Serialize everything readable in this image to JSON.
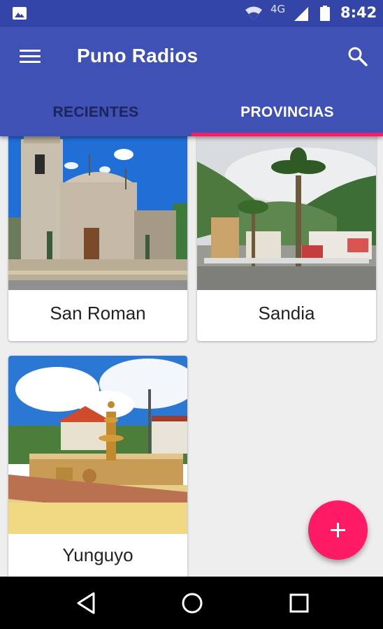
{
  "status_bar": {
    "network": "4G",
    "time": "8:42",
    "icons": [
      "image-notification-icon",
      "wifi-icon",
      "signal-icon",
      "battery-icon"
    ]
  },
  "app_bar": {
    "title": "Puno Radios",
    "menu_icon": "hamburger-menu-icon",
    "search_icon": "search-icon"
  },
  "tabs": [
    {
      "label": "RECIENTES",
      "selected": false
    },
    {
      "label": "PROVINCIAS",
      "selected": true
    }
  ],
  "provinces": [
    {
      "name": "San Roman"
    },
    {
      "name": "Sandia"
    },
    {
      "name": "Yunguyo"
    }
  ],
  "fab": {
    "icon": "plus-icon"
  },
  "nav_bar": {
    "icons": [
      "back-icon",
      "home-icon",
      "recents-icon"
    ]
  },
  "colors": {
    "primary": "#3f51b5",
    "primary_dark": "#3346a8",
    "accent": "#ff1a66",
    "background": "#eeeeee"
  }
}
